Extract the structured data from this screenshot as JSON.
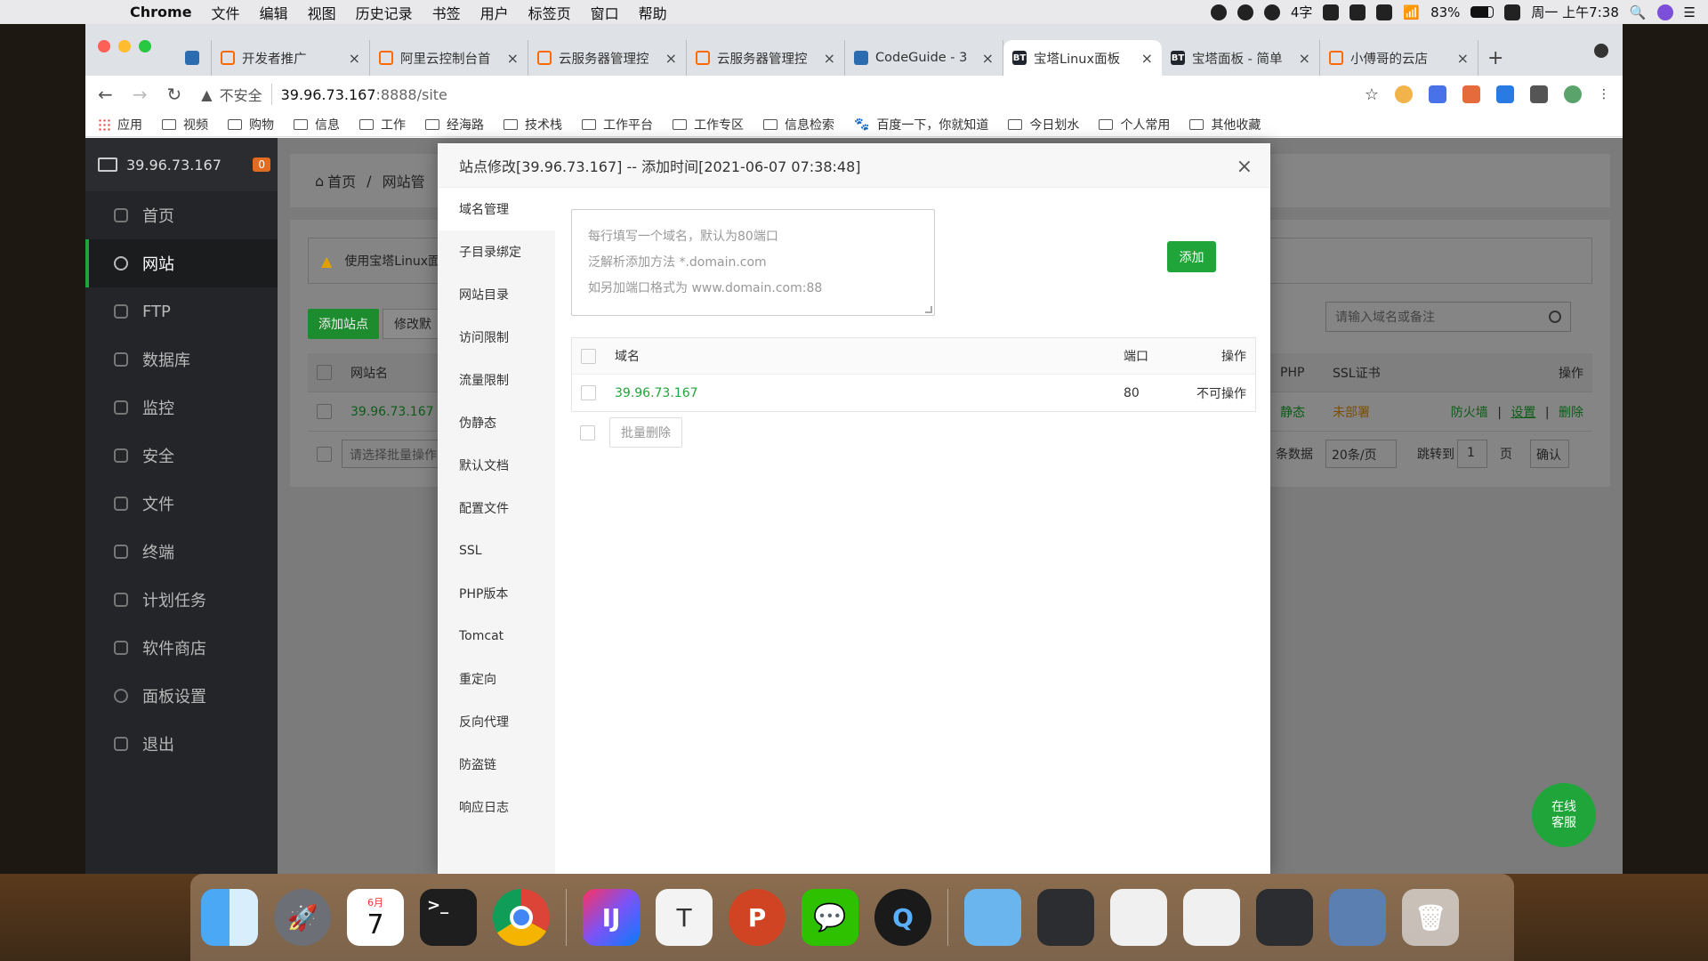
{
  "menubar": {
    "app_name": "Chrome",
    "menus": [
      "文件",
      "编辑",
      "视图",
      "历史记录",
      "书签",
      "用户",
      "标签页",
      "窗口",
      "帮助"
    ],
    "battery": "83%",
    "clock": "周一 上午7:38",
    "ime": "4字"
  },
  "tabs": [
    {
      "title": "开发者推广",
      "icon": "aliyun-icon"
    },
    {
      "title": "阿里云控制台首",
      "icon": "aliyun-icon"
    },
    {
      "title": "云服务器管理控",
      "icon": "aliyun-icon"
    },
    {
      "title": "云服务器管理控",
      "icon": "aliyun-icon"
    },
    {
      "title": "CodeGuide - 3",
      "icon": "codeguide-icon"
    },
    {
      "title": "宝塔Linux面板",
      "icon": "bt-icon",
      "active": true
    },
    {
      "title": "宝塔面板 - 简单",
      "icon": "bt-icon"
    },
    {
      "title": "小傅哥的云店",
      "icon": "aliyun-icon"
    }
  ],
  "address_bar": {
    "security": "不安全",
    "host": "39.96.73.167",
    "path": ":8888/site"
  },
  "bookmarks": [
    "应用",
    "视频",
    "购物",
    "信息",
    "工作",
    "经海路",
    "技术栈",
    "工作平台",
    "工作专区",
    "信息检索",
    "百度一下，你就知道",
    "今日划水",
    "个人常用",
    "其他收藏"
  ],
  "sidebar": {
    "server": "39.96.73.167",
    "badge": "0",
    "items": [
      {
        "label": "首页",
        "icon": "home-icon"
      },
      {
        "label": "网站",
        "icon": "globe-icon",
        "active": true
      },
      {
        "label": "FTP",
        "icon": "ftp-icon"
      },
      {
        "label": "数据库",
        "icon": "database-icon"
      },
      {
        "label": "监控",
        "icon": "monitor-icon"
      },
      {
        "label": "安全",
        "icon": "shield-icon"
      },
      {
        "label": "文件",
        "icon": "folder-icon"
      },
      {
        "label": "终端",
        "icon": "terminal-icon"
      },
      {
        "label": "计划任务",
        "icon": "calendar-icon"
      },
      {
        "label": "软件商店",
        "icon": "grid-icon"
      },
      {
        "label": "面板设置",
        "icon": "gear-icon"
      },
      {
        "label": "退出",
        "icon": "logout-icon"
      }
    ]
  },
  "background_page": {
    "breadcrumb_home": "首页",
    "breadcrumb_sep": "/",
    "breadcrumb_current": "网站管",
    "notice": "使用宝塔Linux面",
    "add_site": "添加站点",
    "modify": "修改默",
    "col_site_name": "网站名",
    "col_php": "PHP",
    "col_ssl": "SSL证书",
    "col_ops": "操作",
    "row_site": "39.96.73.167",
    "row_php": "静态",
    "row_ssl": "未部署",
    "op_firewall": "防火墙",
    "op_settings": "设置",
    "op_delete": "删除",
    "op_sep": "|",
    "batch_placeholder": "请选择批量操作",
    "search_placeholder": "请输入域名或备注",
    "total_suffix": "条数据",
    "page_size": "20条/页",
    "goto": "跳转到",
    "page_num": "1",
    "page_unit": "页",
    "confirm": "确认"
  },
  "modal": {
    "title": "站点修改[39.96.73.167] -- 添加时间[2021-06-07 07:38:48]",
    "close": "×",
    "nav": [
      "域名管理",
      "子目录绑定",
      "网站目录",
      "访问限制",
      "流量限制",
      "伪静态",
      "默认文档",
      "配置文件",
      "SSL",
      "PHP版本",
      "Tomcat",
      "重定向",
      "反向代理",
      "防盗链",
      "响应日志"
    ],
    "textarea_hint_1": "每行填写一个域名，默认为80端口",
    "textarea_hint_2": "泛解析添加方法 *.domain.com",
    "textarea_hint_3": "如另加端口格式为 www.domain.com:88",
    "add_button": "添加",
    "table_headers": {
      "domain": "域名",
      "port": "端口",
      "op": "操作"
    },
    "rows": [
      {
        "domain": "39.96.73.167",
        "port": "80",
        "op": "不可操作"
      }
    ],
    "batch_delete": "批量删除"
  },
  "chat": {
    "line1": "在线",
    "line2": "客服"
  },
  "dock": {
    "calendar_month": "6月",
    "calendar_day": "7"
  }
}
